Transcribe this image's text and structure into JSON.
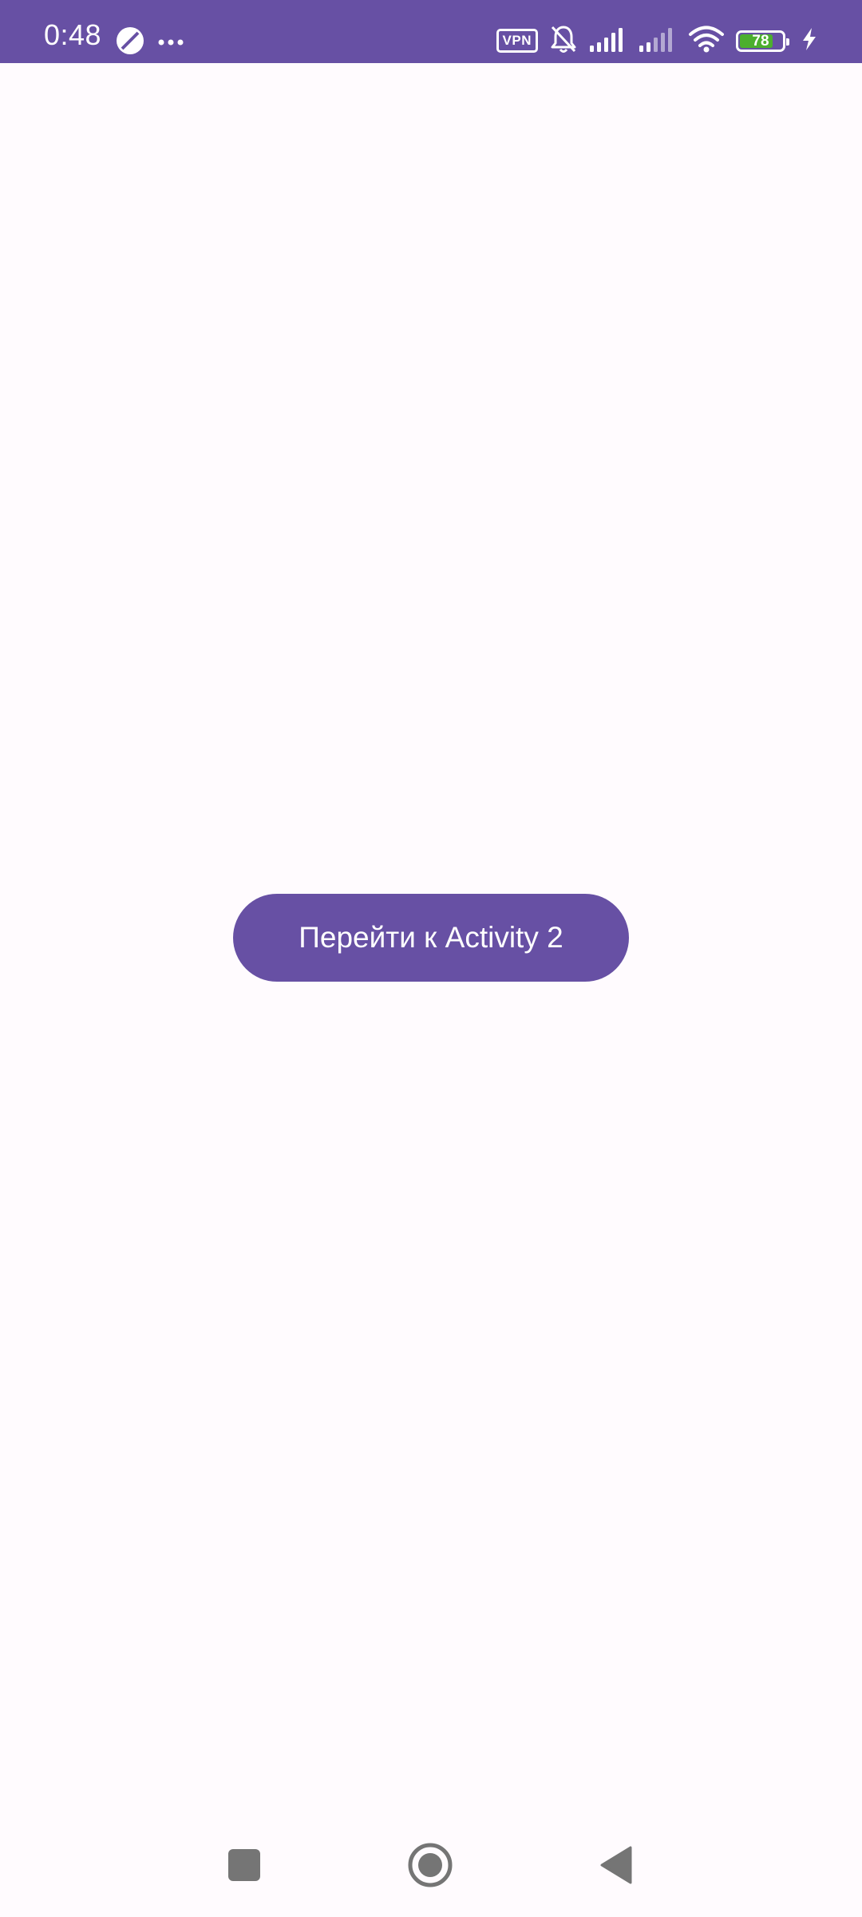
{
  "status_bar": {
    "time": "0:48",
    "vpn_label": "VPN",
    "battery_level": "78",
    "battery_fraction": 0.78,
    "icons": [
      "status-app-icon",
      "more-dots-icon",
      "vpn-icon",
      "bell-muted-icon",
      "signal-icon",
      "signal-icon-secondary",
      "wifi-icon",
      "battery-icon",
      "charging-icon"
    ]
  },
  "main": {
    "button_label": "Перейти к Activity 2"
  },
  "nav_bar": {
    "icons": [
      "recents-square-icon",
      "home-circle-icon",
      "back-triangle-icon"
    ]
  },
  "colors": {
    "primary": "#6750a4",
    "background": "#fffbfe",
    "battery_green": "#4caf2e",
    "nav_icon": "#757575"
  }
}
